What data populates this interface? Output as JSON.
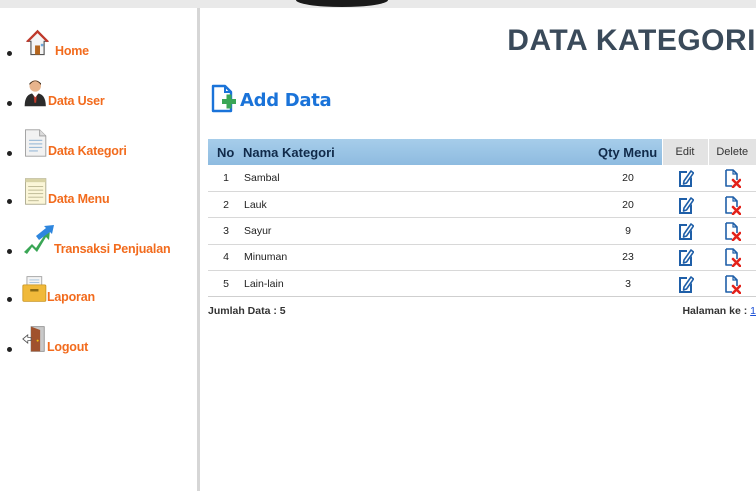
{
  "sidebar": {
    "items": [
      {
        "label": "Home",
        "icon": "home-icon"
      },
      {
        "label": "Data User",
        "icon": "user-icon"
      },
      {
        "label": "Data Kategori",
        "icon": "document-icon"
      },
      {
        "label": "Data Menu",
        "icon": "notepad-icon"
      },
      {
        "label": "Transaksi Penjualan",
        "icon": "transaction-arrows-icon"
      },
      {
        "label": "Laporan",
        "icon": "folder-icon"
      },
      {
        "label": "Logout",
        "icon": "door-exit-icon"
      }
    ]
  },
  "main": {
    "title": "DATA KATEGORI",
    "add_label": "Add Data",
    "table": {
      "headers": {
        "no": "No",
        "nama": "Nama Kategori",
        "qty": "Qty Menu",
        "edit": "Edit",
        "delete": "Delete"
      },
      "rows": [
        {
          "no": "1",
          "nama": "Sambal",
          "qty": "20"
        },
        {
          "no": "2",
          "nama": "Lauk",
          "qty": "20"
        },
        {
          "no": "3",
          "nama": "Sayur",
          "qty": "9"
        },
        {
          "no": "4",
          "nama": "Minuman",
          "qty": "23"
        },
        {
          "no": "5",
          "nama": "Lain-lain",
          "qty": "3"
        }
      ]
    },
    "footer": {
      "jumlah_label": "Jumlah Data : 5",
      "halaman_label": "Halaman ke : ",
      "page": "1"
    }
  },
  "colors": {
    "menu_text": "#f26b1d",
    "title_text": "#3a4a5a",
    "add_text": "#1a73d9",
    "header_blue": "#9cc6e6",
    "header_gray": "#e3e3e3"
  }
}
